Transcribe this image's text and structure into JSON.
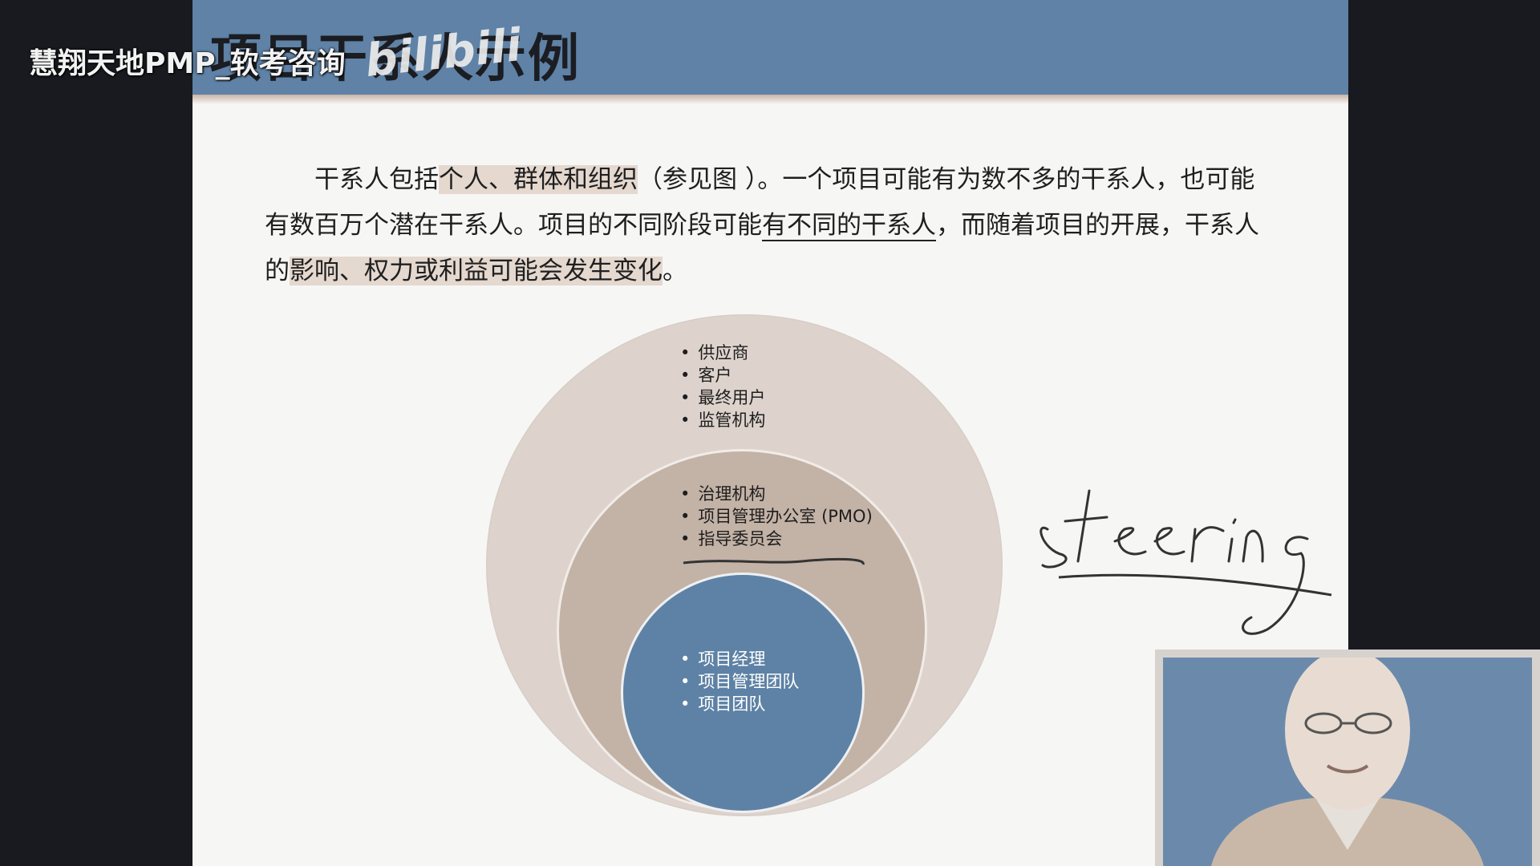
{
  "slide": {
    "title": "项目干系人示例",
    "paragraph_segments": [
      {
        "text": "干系人包括",
        "style": "normal"
      },
      {
        "text": "个人、群体和组织",
        "style": "highlight"
      },
      {
        "text": "（参见图 ）。一个项目可能有为数不多的干系人，也可能有数百万个潜在干系人。项目的不同阶段可能",
        "style": "normal"
      },
      {
        "text": "有不同的干系人",
        "style": "underline"
      },
      {
        "text": "，而随着项目的开展，干系人的",
        "style": "normal"
      },
      {
        "text": "影响、权力或利益可能会发生变化",
        "style": "highlight"
      },
      {
        "text": "。",
        "style": "normal"
      }
    ]
  },
  "diagram": {
    "outer": [
      "供应商",
      "客户",
      "最终用户",
      "监管机构"
    ],
    "middle": [
      "治理机构",
      "项目管理办公室 (PMO)",
      "指导委员会"
    ],
    "inner": [
      "项目经理",
      "项目管理团队",
      "项目团队"
    ]
  },
  "overlay": {
    "watermark": "慧翔天地PMP_软考咨询",
    "bilibili_logo": "bilibili",
    "handwriting": "steering"
  },
  "colors": {
    "title_bar": "#5f82a6",
    "outer_circle": "#ddd3cc",
    "middle_circle": "#c3b2a6",
    "inner_circle": "#5e82a5",
    "highlight": "#e4d8cf"
  }
}
